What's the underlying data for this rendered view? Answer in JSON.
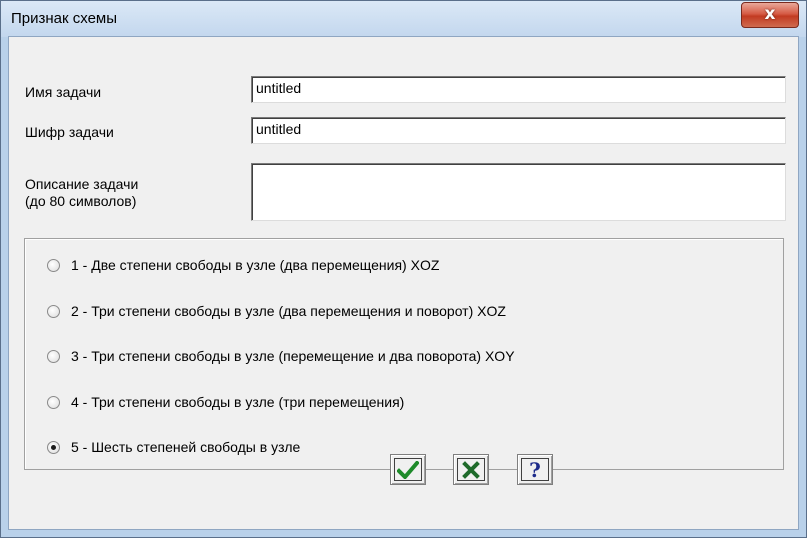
{
  "window": {
    "title": "Признак схемы",
    "close_icon": "close-icon",
    "close_glyph": "x"
  },
  "form": {
    "task_name_label": "Имя задачи",
    "task_name_value": "untitled",
    "task_code_label": "Шифр задачи",
    "task_code_value": "untitled",
    "description_label_line1": "Описание задачи",
    "description_label_line2": "(до 80 символов)",
    "description_value": ""
  },
  "scheme_options": [
    {
      "label": "1 - Две степени свободы в узле (два перемещения) XOZ",
      "checked": false
    },
    {
      "label": "2 - Три степени свободы в узле (два перемещения и поворот) XOZ",
      "checked": false
    },
    {
      "label": "3 - Три степени свободы в узле (перемещение и два поворота) XOY",
      "checked": false
    },
    {
      "label": "4 - Три степени свободы в узле (три перемещения)",
      "checked": false
    },
    {
      "label": "5 - Шесть степеней свободы в узле",
      "checked": true
    }
  ],
  "buttons": {
    "ok_icon": "checkmark-icon",
    "cancel_icon": "cross-icon",
    "help_icon": "question-icon",
    "help_glyph": "?"
  },
  "colors": {
    "title_bar": "#c3d7ee",
    "close_button": "#c23b22",
    "ok_green": "#1e8a2a",
    "cancel_green": "#1e6a2a",
    "help_blue": "#1c2a8a"
  }
}
